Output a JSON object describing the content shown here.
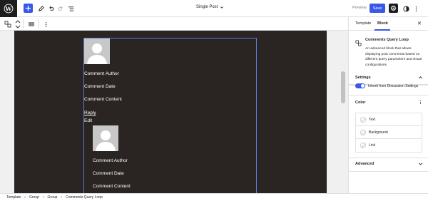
{
  "header": {
    "doc_title": "Single Post",
    "preview_label": "Preview",
    "save_label": "Save"
  },
  "canvas": {
    "comment1": {
      "author": "Comment Author",
      "date": "Comment Date",
      "content": "Comment Content",
      "reply": "Reply",
      "edit": "Edit"
    },
    "comment2": {
      "author": "Comment Author",
      "date": "Comment Date",
      "content": "Comment Content"
    }
  },
  "sidebar": {
    "tabs": [
      {
        "label": "Template",
        "active": false
      },
      {
        "label": "Block",
        "active": true
      }
    ],
    "block": {
      "name": "Comments Query Loop",
      "description": "An advanced block that allows displaying post comments based on different query parameters and visual configurations."
    },
    "settings": {
      "title": "Settings",
      "toggle_label": "Inherit from Discussion Settings",
      "toggle_on": true
    },
    "color": {
      "title": "Color",
      "items": [
        {
          "label": "Text"
        },
        {
          "label": "Background"
        },
        {
          "label": "Link"
        }
      ]
    },
    "advanced": {
      "title": "Advanced"
    }
  },
  "breadcrumb": [
    "Template",
    "Group",
    "Group",
    "Comments Query Loop"
  ],
  "colors": {
    "accent": "#3858e9",
    "canvas_bg": "#2a2422",
    "selection": "#5c7bd8"
  }
}
